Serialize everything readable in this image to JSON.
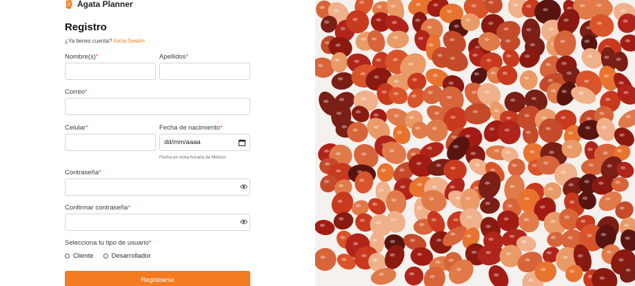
{
  "brand": {
    "name": "Ágata Planner",
    "icon": "agate-logo-icon",
    "color": "#f47b20"
  },
  "form": {
    "title": "Registro",
    "login_prompt": "¿Ya tienes cuenta?",
    "login_link": "Inicia Sesión",
    "required_marker": "*",
    "fields": {
      "nombres": {
        "label": "Nombre(s)",
        "value": ""
      },
      "apellidos": {
        "label": "Apellidos",
        "value": ""
      },
      "correo": {
        "label": "Correo",
        "value": ""
      },
      "celular": {
        "label": "Celular",
        "value": ""
      },
      "fecha": {
        "label": "Fecha de nacimiento",
        "value": "dd/mm/aaaa",
        "hint": "Fecha en zona horaria de México",
        "icon": "calendar-icon"
      },
      "contrasena": {
        "label": "Contraseña",
        "value": "",
        "icon": "eye-icon"
      },
      "confirmar": {
        "label": "Confirmar contraseña",
        "value": "",
        "icon": "eye-icon"
      }
    },
    "user_type": {
      "label": "Selecciona tu tipo de usuario",
      "options": [
        "Cliente",
        "Desarrollador"
      ]
    },
    "submit_label": "Registrarse"
  },
  "colors": {
    "accent": "#f47b20",
    "link": "#f07b1c",
    "required": "#e24b3a"
  },
  "hero_image": {
    "subject": "agate-stones-photo"
  }
}
